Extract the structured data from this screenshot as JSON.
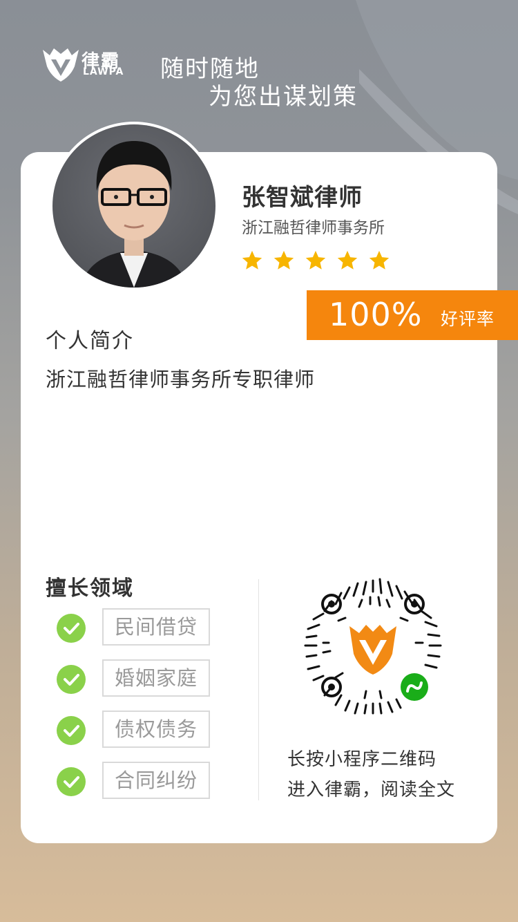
{
  "brand": {
    "name_cn": "律霸",
    "name_en": "LAWPA",
    "logo_icon": "lawpa-shield-v-icon"
  },
  "slogan": {
    "line1": "随时随地",
    "line2": "为您出谋划策"
  },
  "lawyer": {
    "name": "张智斌律师",
    "firm": "浙江融哲律师事务所",
    "rating_stars": 5,
    "rating_percent": "100%",
    "rating_label": "好评率",
    "avatar_icon": "lawyer-portrait"
  },
  "intro": {
    "title": "个人简介",
    "text": "浙江融哲律师事务所专职律师"
  },
  "expertise": {
    "title": "擅长领域",
    "items": [
      "民间借贷",
      "婚姻家庭",
      "债权债务",
      "合同纠纷"
    ]
  },
  "qr": {
    "icon": "mini-program-qr-code",
    "line1": "长按小程序二维码",
    "line2": "进入律霸，阅读全文"
  },
  "colors": {
    "accent": "#f5860d",
    "star": "#f7b500",
    "check": "#8ad14a"
  }
}
